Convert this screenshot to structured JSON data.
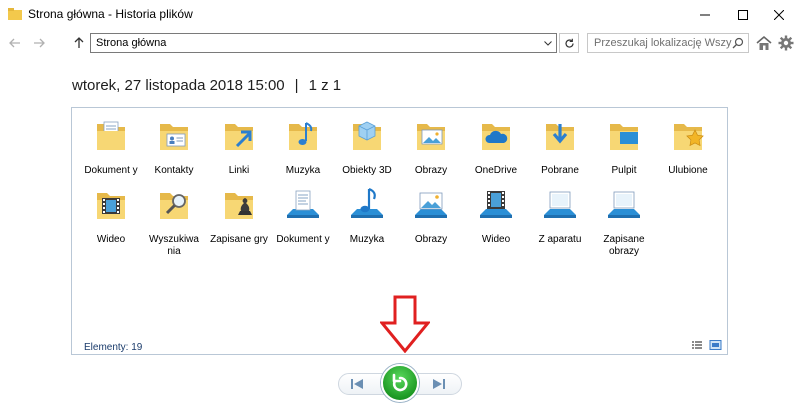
{
  "window": {
    "title": "Strona główna - Historia plików"
  },
  "navbar": {
    "address": "Strona główna",
    "search_placeholder": "Przeszukaj lokalizację Wszystkie"
  },
  "snapshot": {
    "date": "wtorek, 27 listopada 2018 15:00",
    "separator": "|",
    "page": "1 z 1"
  },
  "items": [
    {
      "label": "Dokument y",
      "icon": "documents-folder-icon"
    },
    {
      "label": "Kontakty",
      "icon": "contacts-folder-icon"
    },
    {
      "label": "Linki",
      "icon": "links-folder-icon"
    },
    {
      "label": "Muzyka",
      "icon": "music-folder-icon"
    },
    {
      "label": "Obiekty 3D",
      "icon": "objects-3d-folder-icon"
    },
    {
      "label": "Obrazy",
      "icon": "pictures-folder-icon"
    },
    {
      "label": "OneDrive",
      "icon": "onedrive-folder-icon"
    },
    {
      "label": "Pobrane",
      "icon": "downloads-folder-icon"
    },
    {
      "label": "Pulpit",
      "icon": "desktop-folder-icon"
    },
    {
      "label": "Ulubione",
      "icon": "favorites-folder-icon"
    },
    {
      "label": "Wideo",
      "icon": "videos-folder-icon"
    },
    {
      "label": "Wyszukiwa nia",
      "icon": "searches-folder-icon"
    },
    {
      "label": "Zapisane gry",
      "icon": "saved-games-folder-icon"
    },
    {
      "label": "Dokument y",
      "icon": "documents-library-icon"
    },
    {
      "label": "Muzyka",
      "icon": "music-library-icon"
    },
    {
      "label": "Obrazy",
      "icon": "pictures-library-icon"
    },
    {
      "label": "Wideo",
      "icon": "videos-library-icon"
    },
    {
      "label": "Z aparatu",
      "icon": "camera-roll-library-icon"
    },
    {
      "label": "Zapisane obrazy",
      "icon": "saved-pictures-library-icon"
    }
  ],
  "status": {
    "count": "Elementy: 19"
  },
  "colors": {
    "accent_green": "#1e9a25",
    "annotation_red": "#e02020",
    "folder_yellow": "#f7d774",
    "library_blue": "#2b8fd6"
  }
}
